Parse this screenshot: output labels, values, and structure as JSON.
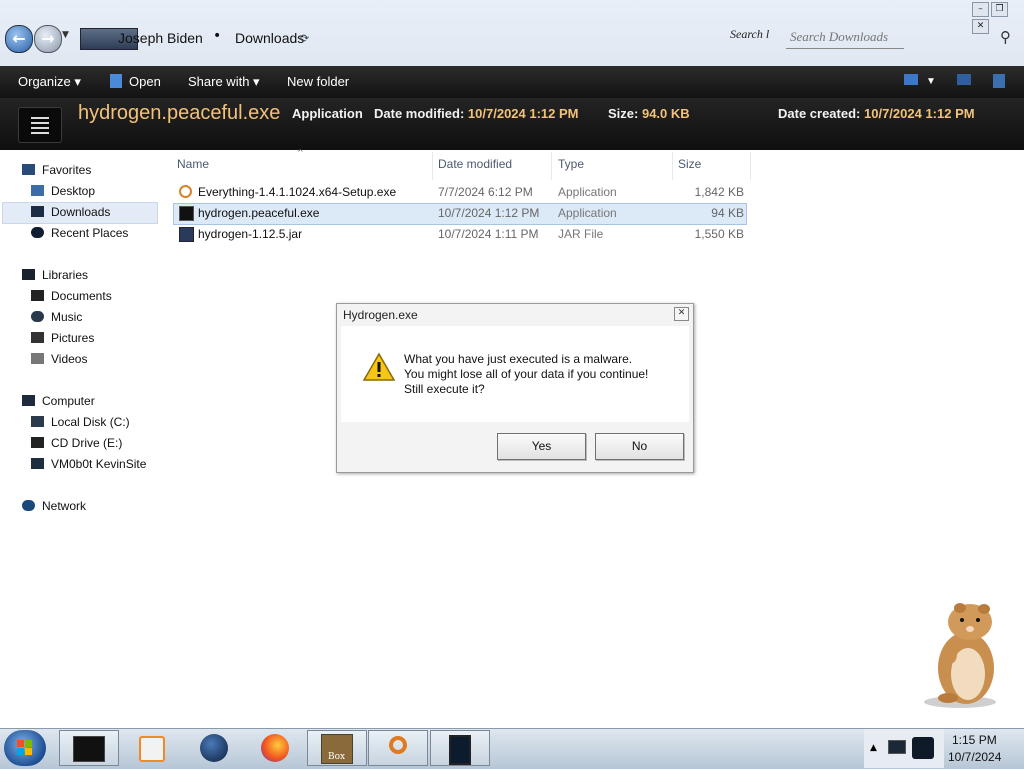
{
  "address": {
    "user": "Joseph Biden",
    "separator": "•",
    "folder": "Downloads",
    "search_label": "Search l",
    "search_placeholder": "Search Downloads"
  },
  "toolbar": {
    "organize": "Organize ▾",
    "open": "Open",
    "share_with": "Share with ▾",
    "new_folder": "New folder"
  },
  "details": {
    "file_name": "hydrogen.peaceful.exe",
    "type": "Application",
    "date_modified_label": "Date modified:",
    "date_modified_value": "10/7/2024 1:12 PM",
    "size_label": "Size:",
    "size_value": "94.0 KB",
    "date_created_label": "Date created:",
    "date_created_value": "10/7/2024 1:12 PM"
  },
  "nav": {
    "favorites": "Favorites",
    "desktop": "Desktop",
    "downloads": "Downloads",
    "recent_places": "Recent Places",
    "libraries": "Libraries",
    "documents": "Documents",
    "music": "Music",
    "pictures": "Pictures",
    "videos": "Videos",
    "computer": "Computer",
    "local_disk": "Local Disk (C:)",
    "cd_drive": "CD Drive (E:)",
    "network_share": "VM0b0t KevinSite",
    "network": "Network"
  },
  "columns": {
    "name": "Name",
    "date_modified": "Date modified",
    "type": "Type",
    "size": "Size"
  },
  "files": [
    {
      "name": "Everything-1.4.1.1024.x64-Setup.exe",
      "date": "7/7/2024 6:12 PM",
      "type": "Application",
      "size": "1,842 KB",
      "icon": "magnifier-icon"
    },
    {
      "name": "hydrogen.peaceful.exe",
      "date": "10/7/2024 1:12 PM",
      "type": "Application",
      "size": "94 KB",
      "icon": "exe-icon",
      "selected": true
    },
    {
      "name": "hydrogen-1.12.5.jar",
      "date": "10/7/2024 1:11 PM",
      "type": "JAR File",
      "size": "1,550 KB",
      "icon": "jar-icon"
    }
  ],
  "dialog": {
    "title": "Hydrogen.exe",
    "line1": "What you have just executed is a malware.",
    "line2": "You might lose all of your data if you continue!",
    "line3": "Still execute it?",
    "yes": "Yes",
    "no": "No"
  },
  "taskbar": {
    "time": "1:15 PM",
    "date": "10/7/2024",
    "box_label": "Box"
  },
  "colors": {
    "accent_orange": "#f2c27a",
    "toolbar_dark": "#1a1a1a",
    "selection": "#dce9f7"
  }
}
